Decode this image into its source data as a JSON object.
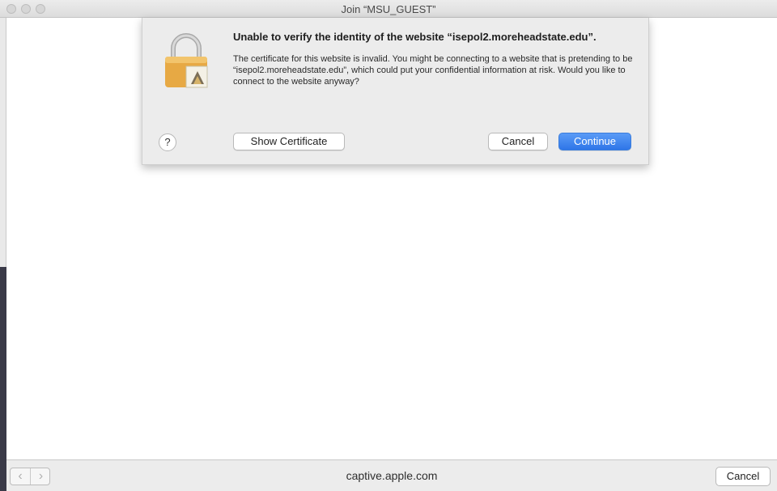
{
  "window": {
    "title": "Join “MSU_GUEST”"
  },
  "dialog": {
    "icon": "padlock-certificate-icon",
    "title": "Unable to verify the identity of the website “isepol2.moreheadstate.edu”.",
    "body": "The certificate for this website is invalid. You might be connecting to a website that is pretending to be “isepol2.moreheadstate.edu”, which could put your confidential information at risk. Would you like to connect to the website anyway?",
    "help_label": "?",
    "show_certificate_label": "Show Certificate",
    "cancel_label": "Cancel",
    "continue_label": "Continue",
    "accent_color": "#2f76e8"
  },
  "bottombar": {
    "back_icon": "chevron-left-icon",
    "forward_icon": "chevron-right-icon",
    "back_glyph": "‹",
    "forward_glyph": "›",
    "url": "captive.apple.com",
    "cancel_label": "Cancel"
  }
}
